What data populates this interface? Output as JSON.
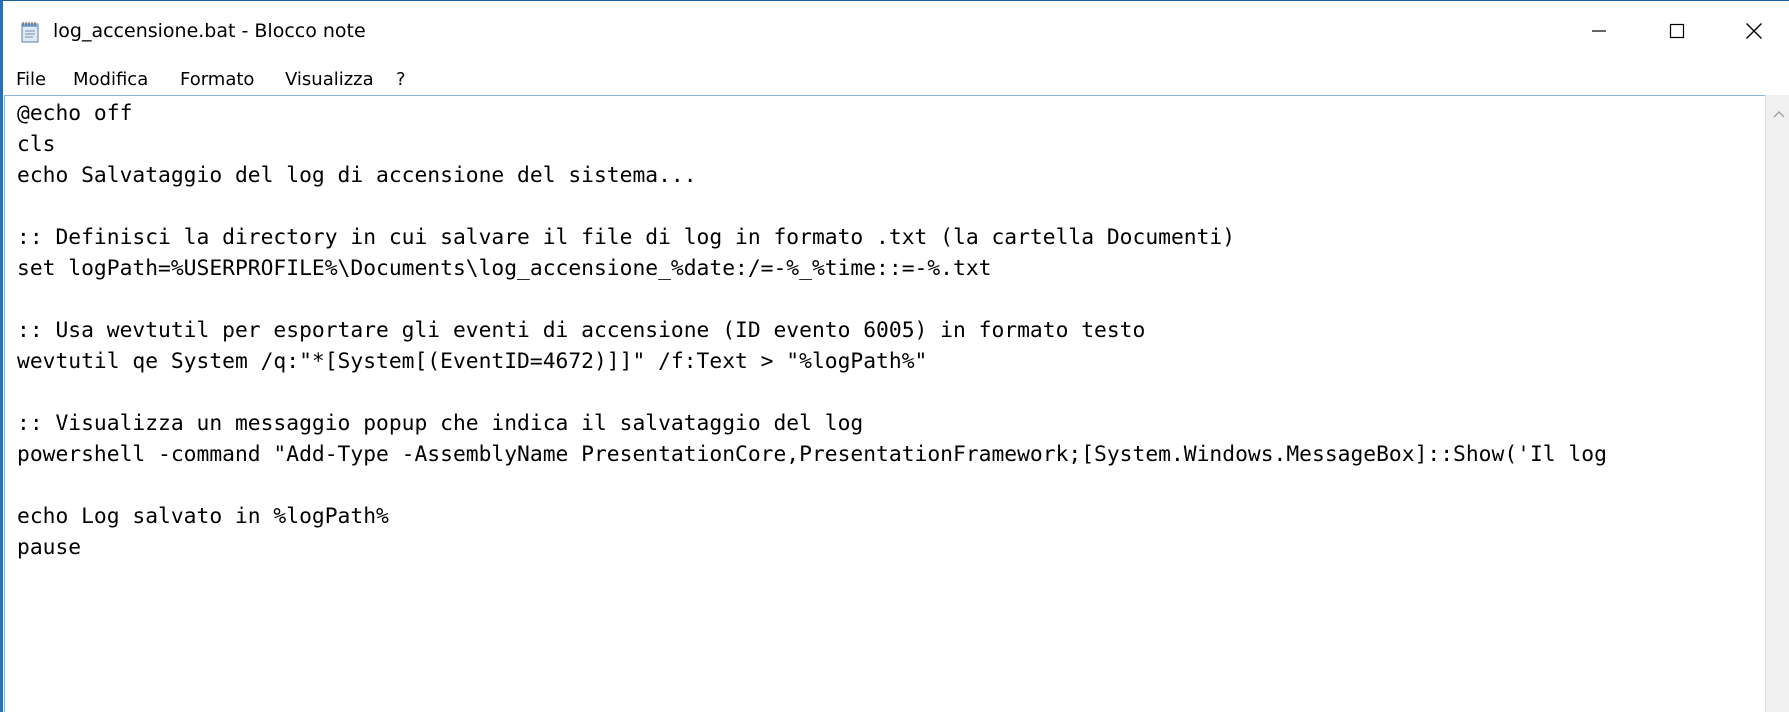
{
  "window": {
    "title": "log_accensione.bat - Blocco note"
  },
  "menu": {
    "items": [
      "File",
      "Modifica",
      "Formato",
      "Visualizza",
      "?"
    ]
  },
  "editor": {
    "lines": [
      "@echo off",
      "cls",
      "echo Salvataggio del log di accensione del sistema...",
      "",
      ":: Definisci la directory in cui salvare il file di log in formato .txt (la cartella Documenti)",
      "set logPath=%USERPROFILE%\\Documents\\log_accensione_%date:/=-%_%time::=-%.txt",
      "",
      ":: Usa wevtutil per esportare gli eventi di accensione (ID evento 6005) in formato testo",
      "wevtutil qe System /q:\"*[System[(EventID=4672)]]\" /f:Text > \"%logPath%\"",
      "",
      ":: Visualizza un messaggio popup che indica il salvataggio del log",
      "powershell -command \"Add-Type -AssemblyName PresentationCore,PresentationFramework;[System.Windows.MessageBox]::Show('Il log",
      "",
      "echo Log salvato in %logPath%",
      "pause"
    ]
  },
  "icons": {
    "app": "notepad-icon",
    "minimize": "minimize-icon",
    "maximize": "maximize-icon",
    "close": "close-icon",
    "scroll_up": "scroll-up-arrow-icon"
  },
  "colors": {
    "window_border": "#2a6fb8",
    "background": "#ffffff",
    "text": "#000000"
  }
}
